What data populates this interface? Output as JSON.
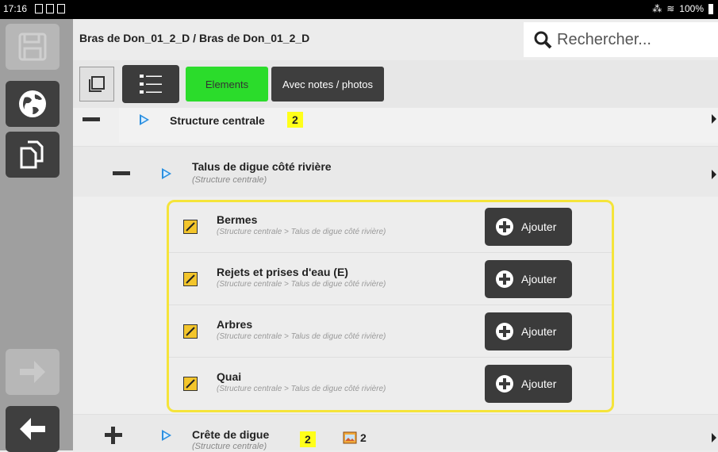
{
  "status_bar": {
    "time": "17:16",
    "battery": "100%"
  },
  "header": {
    "breadcrumb": "Bras de Don_01_2_D / Bras de Don_01_2_D",
    "search_placeholder": "Rechercher..."
  },
  "toolbar": {
    "elements_label": "Elements",
    "notes_label": "Avec notes / photos"
  },
  "tree": {
    "structure": {
      "title": "Structure centrale",
      "count": "2"
    },
    "talus": {
      "title": "Talus de digue côté rivière",
      "subtitle": "(Structure centrale)"
    },
    "items": [
      {
        "title": "Bermes",
        "subtitle": "(Structure centrale > Talus de digue côté rivière)",
        "button": "Ajouter"
      },
      {
        "title": "Rejets et prises d'eau (E)",
        "subtitle": "(Structure centrale > Talus de digue côté rivière)",
        "button": "Ajouter"
      },
      {
        "title": "Arbres",
        "subtitle": "(Structure centrale > Talus de digue côté rivière)",
        "button": "Ajouter"
      },
      {
        "title": "Quai",
        "subtitle": "(Structure centrale > Talus de digue côté rivière)",
        "button": "Ajouter"
      }
    ],
    "crete": {
      "title": "Crête de digue",
      "subtitle": "(Structure centrale)",
      "count": "2",
      "photo_count": "2"
    }
  }
}
